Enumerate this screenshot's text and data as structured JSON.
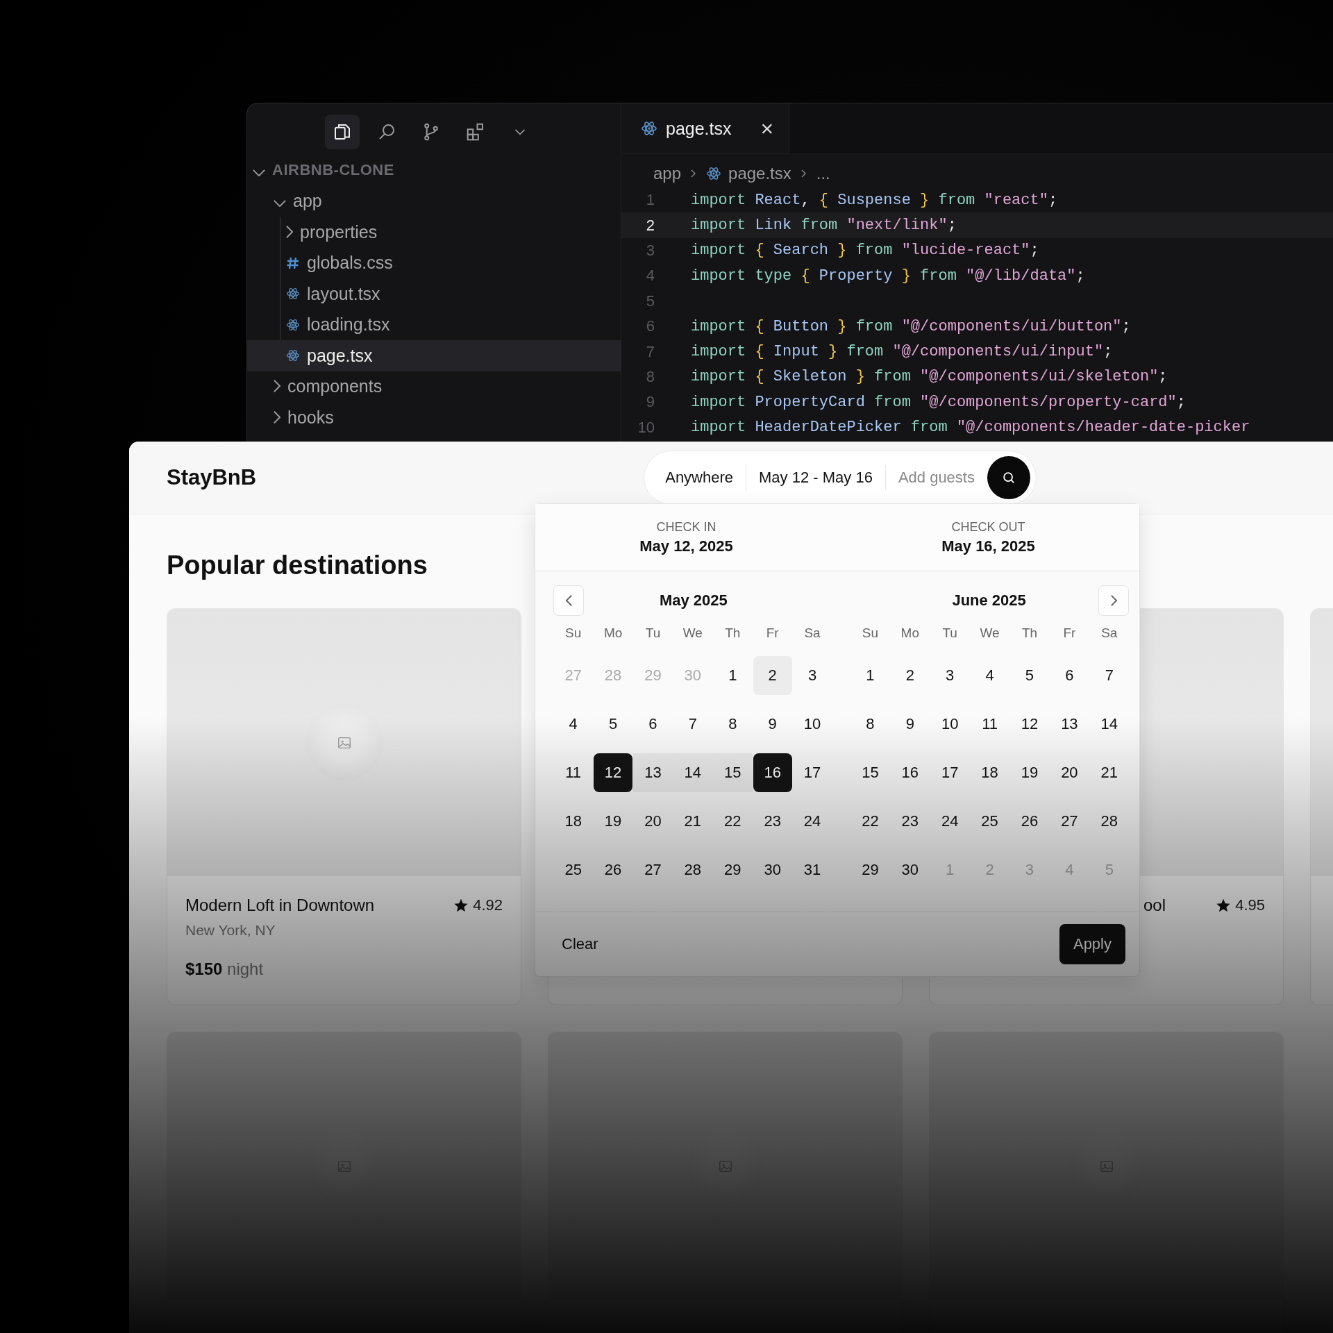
{
  "editor": {
    "tree": {
      "label": "AIRBNB-CLONE",
      "expanded": true,
      "children": [
        {
          "label": "app",
          "kind": "folder",
          "expanded": true,
          "selected": false,
          "children": [
            {
              "label": "properties",
              "kind": "folder",
              "expanded": false,
              "selected": false
            },
            {
              "label": "globals.css",
              "kind": "css",
              "selected": false
            },
            {
              "label": "layout.tsx",
              "kind": "react",
              "selected": false
            },
            {
              "label": "loading.tsx",
              "kind": "react",
              "selected": false
            },
            {
              "label": "page.tsx",
              "kind": "react",
              "selected": true
            }
          ]
        },
        {
          "label": "components",
          "kind": "folder",
          "expanded": false,
          "selected": false
        },
        {
          "label": "hooks",
          "kind": "folder",
          "expanded": false,
          "selected": false
        }
      ]
    },
    "tab": {
      "label": "page.tsx",
      "close": "×"
    },
    "breadcrumb": [
      "app",
      "page.tsx",
      "..."
    ],
    "lines": [
      {
        "n": "1",
        "current": false,
        "tokens": [
          {
            "t": "import ",
            "kind": "kw"
          },
          {
            "t": "React",
            "kind": "id"
          },
          {
            "t": ", ",
            "kind": "p"
          },
          {
            "t": "{ ",
            "kind": "b"
          },
          {
            "t": "Suspense ",
            "kind": "id"
          },
          {
            "t": "} ",
            "kind": "b"
          },
          {
            "t": "from ",
            "kind": "kw"
          },
          {
            "t": "\"react\"",
            "kind": "s"
          },
          {
            "t": ";",
            "kind": "p"
          }
        ]
      },
      {
        "n": "2",
        "current": true,
        "tokens": [
          {
            "t": "import ",
            "kind": "kw"
          },
          {
            "t": "Link ",
            "kind": "id"
          },
          {
            "t": "from ",
            "kind": "kw"
          },
          {
            "t": "\"next/link\"",
            "kind": "s"
          },
          {
            "t": ";",
            "kind": "p"
          }
        ]
      },
      {
        "n": "3",
        "current": false,
        "tokens": [
          {
            "t": "import ",
            "kind": "kw"
          },
          {
            "t": "{ ",
            "kind": "b"
          },
          {
            "t": "Search ",
            "kind": "id"
          },
          {
            "t": "} ",
            "kind": "b"
          },
          {
            "t": "from ",
            "kind": "kw"
          },
          {
            "t": "\"lucide-react\"",
            "kind": "s"
          },
          {
            "t": ";",
            "kind": "p"
          }
        ]
      },
      {
        "n": "4",
        "current": false,
        "tokens": [
          {
            "t": "import type ",
            "kind": "kw"
          },
          {
            "t": "{ ",
            "kind": "b"
          },
          {
            "t": "Property ",
            "kind": "id"
          },
          {
            "t": "} ",
            "kind": "b"
          },
          {
            "t": "from ",
            "kind": "kw"
          },
          {
            "t": "\"@/lib/data\"",
            "kind": "s"
          },
          {
            "t": ";",
            "kind": "p"
          }
        ]
      },
      {
        "n": "5",
        "current": false
      },
      {
        "n": "6",
        "current": false,
        "tokens": [
          {
            "t": "import ",
            "kind": "kw"
          },
          {
            "t": "{ ",
            "kind": "b"
          },
          {
            "t": "Button ",
            "kind": "id"
          },
          {
            "t": "} ",
            "kind": "b"
          },
          {
            "t": "from ",
            "kind": "kw"
          },
          {
            "t": "\"@/components/ui/button\"",
            "kind": "s"
          },
          {
            "t": ";",
            "kind": "p"
          }
        ]
      },
      {
        "n": "7",
        "current": false,
        "tokens": [
          {
            "t": "import ",
            "kind": "kw"
          },
          {
            "t": "{ ",
            "kind": "b"
          },
          {
            "t": "Input ",
            "kind": "id"
          },
          {
            "t": "} ",
            "kind": "b"
          },
          {
            "t": "from ",
            "kind": "kw"
          },
          {
            "t": "\"@/components/ui/input\"",
            "kind": "s"
          },
          {
            "t": ";",
            "kind": "p"
          }
        ]
      },
      {
        "n": "8",
        "current": false,
        "tokens": [
          {
            "t": "import ",
            "kind": "kw"
          },
          {
            "t": "{ ",
            "kind": "b"
          },
          {
            "t": "Skeleton ",
            "kind": "id"
          },
          {
            "t": "} ",
            "kind": "b"
          },
          {
            "t": "from ",
            "kind": "kw"
          },
          {
            "t": "\"@/components/ui/skeleton\"",
            "kind": "s"
          },
          {
            "t": ";",
            "kind": "p"
          }
        ]
      },
      {
        "n": "9",
        "current": false,
        "tokens": [
          {
            "t": "import ",
            "kind": "kw"
          },
          {
            "t": "PropertyCard ",
            "kind": "id"
          },
          {
            "t": "from ",
            "kind": "kw"
          },
          {
            "t": "\"@/components/property-card\"",
            "kind": "s"
          },
          {
            "t": ";",
            "kind": "p"
          }
        ]
      },
      {
        "n": "10",
        "current": false,
        "tokens": [
          {
            "t": "import ",
            "kind": "kw"
          },
          {
            "t": "HeaderDatePicker ",
            "kind": "id"
          },
          {
            "t": "from ",
            "kind": "kw"
          },
          {
            "t": "\"@/components/header-date-picker",
            "kind": "s"
          }
        ]
      }
    ]
  },
  "app": {
    "logo": "StayBnB",
    "search": {
      "location": "Anywhere",
      "dates": "May 12 - May 16",
      "guests_placeholder": "Add guests"
    },
    "heading": "Popular destinations",
    "cards": [
      {
        "kind": "listing",
        "title": "Modern Loft in Downtown",
        "location": "New York, NY",
        "rating": "4.92",
        "price": "$150",
        "unit": "night"
      },
      {
        "kind": "placeholder"
      },
      {
        "kind": "listing",
        "title": "ool",
        "rating": "4.95"
      },
      {
        "kind": "placeholder"
      },
      {
        "kind": "placeholder"
      },
      {
        "kind": "placeholder"
      },
      {
        "kind": "placeholder"
      }
    ],
    "datepicker": {
      "check_in": {
        "label": "CHECK IN",
        "value": "May 12, 2025"
      },
      "check_out": {
        "label": "CHECK OUT",
        "value": "May 16, 2025"
      },
      "months": [
        {
          "title": "May 2025",
          "weekdays": [
            "Su",
            "Mo",
            "Tu",
            "We",
            "Th",
            "Fr",
            "Sa"
          ],
          "days": [
            {
              "d": "27",
              "kind": "outside"
            },
            {
              "d": "28",
              "kind": "outside"
            },
            {
              "d": "29",
              "kind": "outside"
            },
            {
              "d": "30",
              "kind": "outside"
            },
            {
              "d": "1",
              "kind": "day"
            },
            {
              "d": "2",
              "kind": "today"
            },
            {
              "d": "3",
              "kind": "day"
            },
            {
              "d": "4",
              "kind": "day"
            },
            {
              "d": "5",
              "kind": "day"
            },
            {
              "d": "6",
              "kind": "day"
            },
            {
              "d": "7",
              "kind": "day"
            },
            {
              "d": "8",
              "kind": "day"
            },
            {
              "d": "9",
              "kind": "day"
            },
            {
              "d": "10",
              "kind": "day"
            },
            {
              "d": "11",
              "kind": "day"
            },
            {
              "d": "12",
              "kind": "start"
            },
            {
              "d": "13",
              "kind": "range"
            },
            {
              "d": "14",
              "kind": "range"
            },
            {
              "d": "15",
              "kind": "range"
            },
            {
              "d": "16",
              "kind": "end"
            },
            {
              "d": "17",
              "kind": "day"
            },
            {
              "d": "18",
              "kind": "day"
            },
            {
              "d": "19",
              "kind": "day"
            },
            {
              "d": "20",
              "kind": "day"
            },
            {
              "d": "21",
              "kind": "day"
            },
            {
              "d": "22",
              "kind": "day"
            },
            {
              "d": "23",
              "kind": "day"
            },
            {
              "d": "24",
              "kind": "day"
            },
            {
              "d": "25",
              "kind": "day"
            },
            {
              "d": "26",
              "kind": "day"
            },
            {
              "d": "27",
              "kind": "day"
            },
            {
              "d": "28",
              "kind": "day"
            },
            {
              "d": "29",
              "kind": "day"
            },
            {
              "d": "30",
              "kind": "day"
            },
            {
              "d": "31",
              "kind": "day"
            }
          ]
        },
        {
          "title": "June 2025",
          "weekdays": [
            "Su",
            "Mo",
            "Tu",
            "We",
            "Th",
            "Fr",
            "Sa"
          ],
          "days": [
            {
              "d": "1",
              "kind": "day"
            },
            {
              "d": "2",
              "kind": "day"
            },
            {
              "d": "3",
              "kind": "day"
            },
            {
              "d": "4",
              "kind": "day"
            },
            {
              "d": "5",
              "kind": "day"
            },
            {
              "d": "6",
              "kind": "day"
            },
            {
              "d": "7",
              "kind": "day"
            },
            {
              "d": "8",
              "kind": "day"
            },
            {
              "d": "9",
              "kind": "day"
            },
            {
              "d": "10",
              "kind": "day"
            },
            {
              "d": "11",
              "kind": "day"
            },
            {
              "d": "12",
              "kind": "day"
            },
            {
              "d": "13",
              "kind": "day"
            },
            {
              "d": "14",
              "kind": "day"
            },
            {
              "d": "15",
              "kind": "day"
            },
            {
              "d": "16",
              "kind": "day"
            },
            {
              "d": "17",
              "kind": "day"
            },
            {
              "d": "18",
              "kind": "day"
            },
            {
              "d": "19",
              "kind": "day"
            },
            {
              "d": "20",
              "kind": "day"
            },
            {
              "d": "21",
              "kind": "day"
            },
            {
              "d": "22",
              "kind": "day"
            },
            {
              "d": "23",
              "kind": "day"
            },
            {
              "d": "24",
              "kind": "day"
            },
            {
              "d": "25",
              "kind": "day"
            },
            {
              "d": "26",
              "kind": "day"
            },
            {
              "d": "27",
              "kind": "day"
            },
            {
              "d": "28",
              "kind": "day"
            },
            {
              "d": "29",
              "kind": "day"
            },
            {
              "d": "30",
              "kind": "day"
            },
            {
              "d": "1",
              "kind": "outside"
            },
            {
              "d": "2",
              "kind": "outside"
            },
            {
              "d": "3",
              "kind": "outside"
            },
            {
              "d": "4",
              "kind": "outside"
            },
            {
              "d": "5",
              "kind": "outside"
            }
          ]
        }
      ],
      "clear": "Clear",
      "apply": "Apply"
    }
  }
}
